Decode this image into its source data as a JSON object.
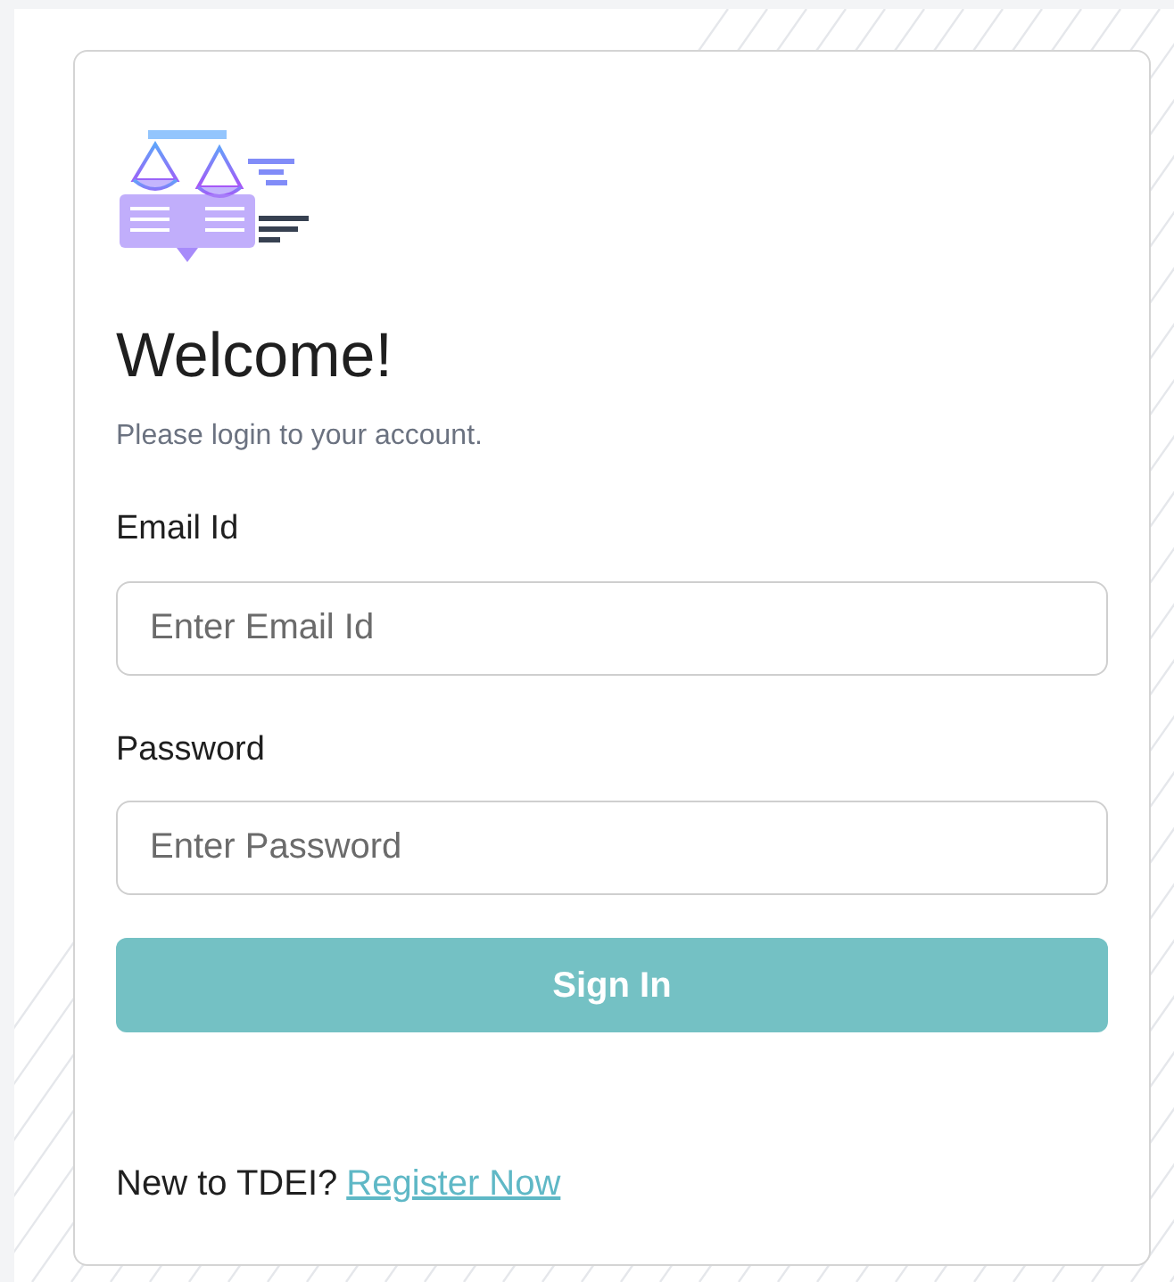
{
  "heading": "Welcome!",
  "subtitle": "Please login to your account.",
  "fields": [
    {
      "label": "Email Id",
      "placeholder": "Enter Email Id"
    },
    {
      "label": "Password",
      "placeholder": "Enter Password"
    }
  ],
  "submit": "Sign In",
  "footer": {
    "text": "New to TDEI?",
    "link": "Register Now"
  }
}
